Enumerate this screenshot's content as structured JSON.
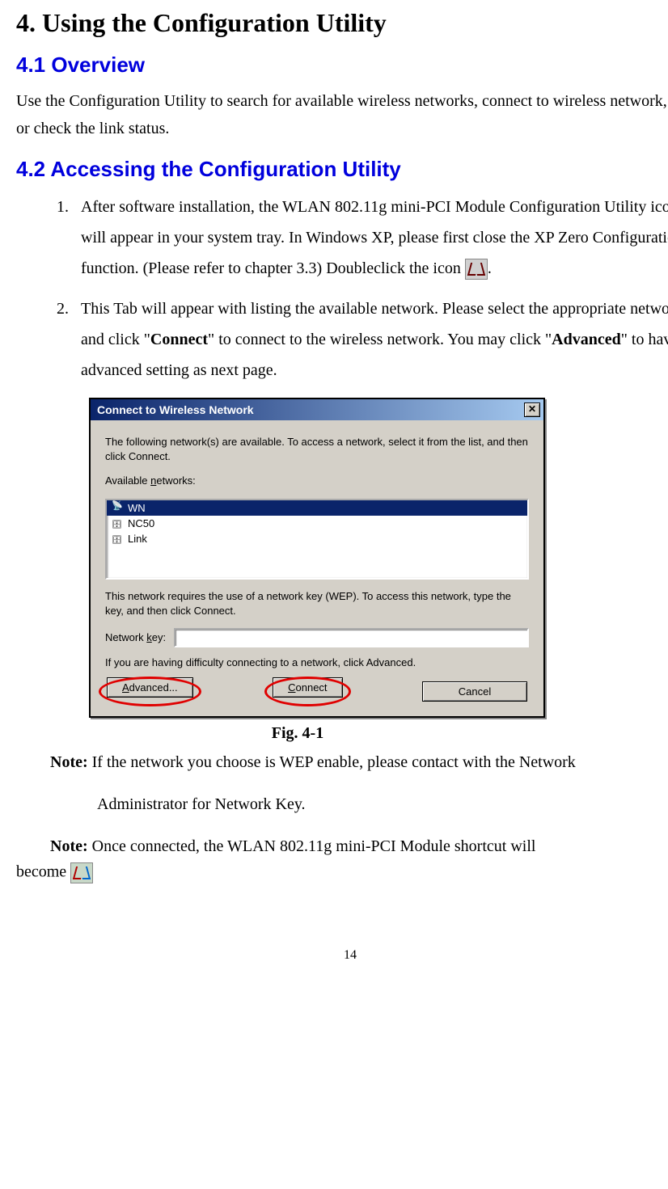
{
  "heading1": "4. Using the Configuration Utility",
  "section1": {
    "title": "4.1 Overview",
    "text": "Use the Configuration Utility to search for available wireless networks, connect to wireless network, or check the link status."
  },
  "section2": {
    "title": "4.2 Accessing the Configuration Utility",
    "items": [
      {
        "pre": "After software installation, the WLAN 802.11g mini-PCI Module Configuration Utility icon will appear in your system tray. In Windows XP, please first close the XP Zero Configuration function. (Please refer to chapter 3.3) Doubleclick the icon ",
        "post": "."
      },
      {
        "pre": "This Tab will appear with listing the available network. Please select the appropriate network and click \"",
        "b1": "Connect",
        "mid": "\" to connect to the wireless network. You may click \"",
        "b2": "Advanced",
        "post": "\" to have advanced setting as next page."
      }
    ]
  },
  "dialog": {
    "title": "Connect to Wireless Network",
    "intro": "The following network(s) are available. To access a network, select it from the list, and then click Connect.",
    "available_label_pre": "Available ",
    "available_label_u": "n",
    "available_label_post": "etworks:",
    "networks": [
      {
        "name": "WN",
        "selected": true
      },
      {
        "name": "NC50",
        "selected": false
      },
      {
        "name": "Link",
        "selected": false
      }
    ],
    "wep_text": "This network requires the use of a network key (WEP). To access this network, type the key, and then click Connect.",
    "key_label_pre": "Network ",
    "key_label_u": "k",
    "key_label_post": "ey:",
    "difficulty_text": "If you are having difficulty connecting to a network, click Advanced.",
    "buttons": {
      "advanced_u": "A",
      "advanced_rest": "dvanced...",
      "connect_u": "C",
      "connect_rest": "onnect",
      "cancel": "Cancel"
    }
  },
  "fig_caption": "Fig. 4-1",
  "note1_label": "Note:",
  "note1_text": " If the network you choose is WEP enable, please contact with the Network",
  "note1_cont": "Administrator for Network Key.",
  "note2_label": "Note:",
  "note2_text": " Once connected, the WLAN 802.11g mini-PCI Module shortcut will",
  "become": "become ",
  "pagenum": "14"
}
